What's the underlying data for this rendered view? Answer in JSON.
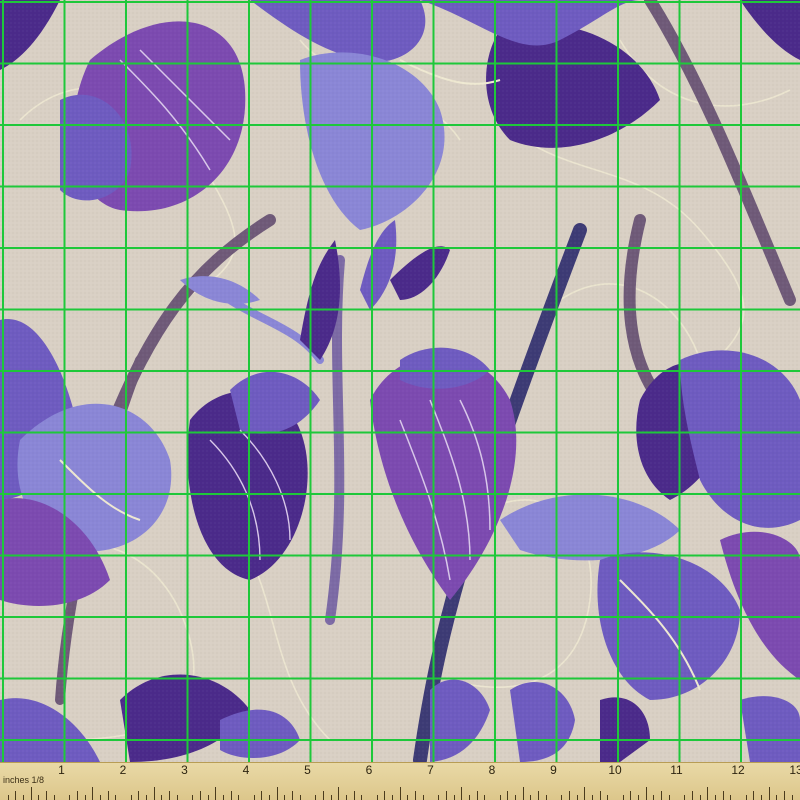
{
  "colors": {
    "background": "#d9d0c4",
    "grid_line": "#1ec83a",
    "petal_dark": "#4b2a8a",
    "petal_mid": "#6e5bc0",
    "petal_light": "#8a86d6",
    "petal_magenta": "#7c4ab0",
    "stem": "#6f5a78",
    "outline_cream": "#efe9d2",
    "ruler": "#e4d49d"
  },
  "ruler": {
    "label": "inches 1/8",
    "numbers": [
      "1",
      "2",
      "3",
      "4",
      "5",
      "6",
      "7",
      "8",
      "9",
      "10",
      "11",
      "12",
      "13"
    ]
  }
}
